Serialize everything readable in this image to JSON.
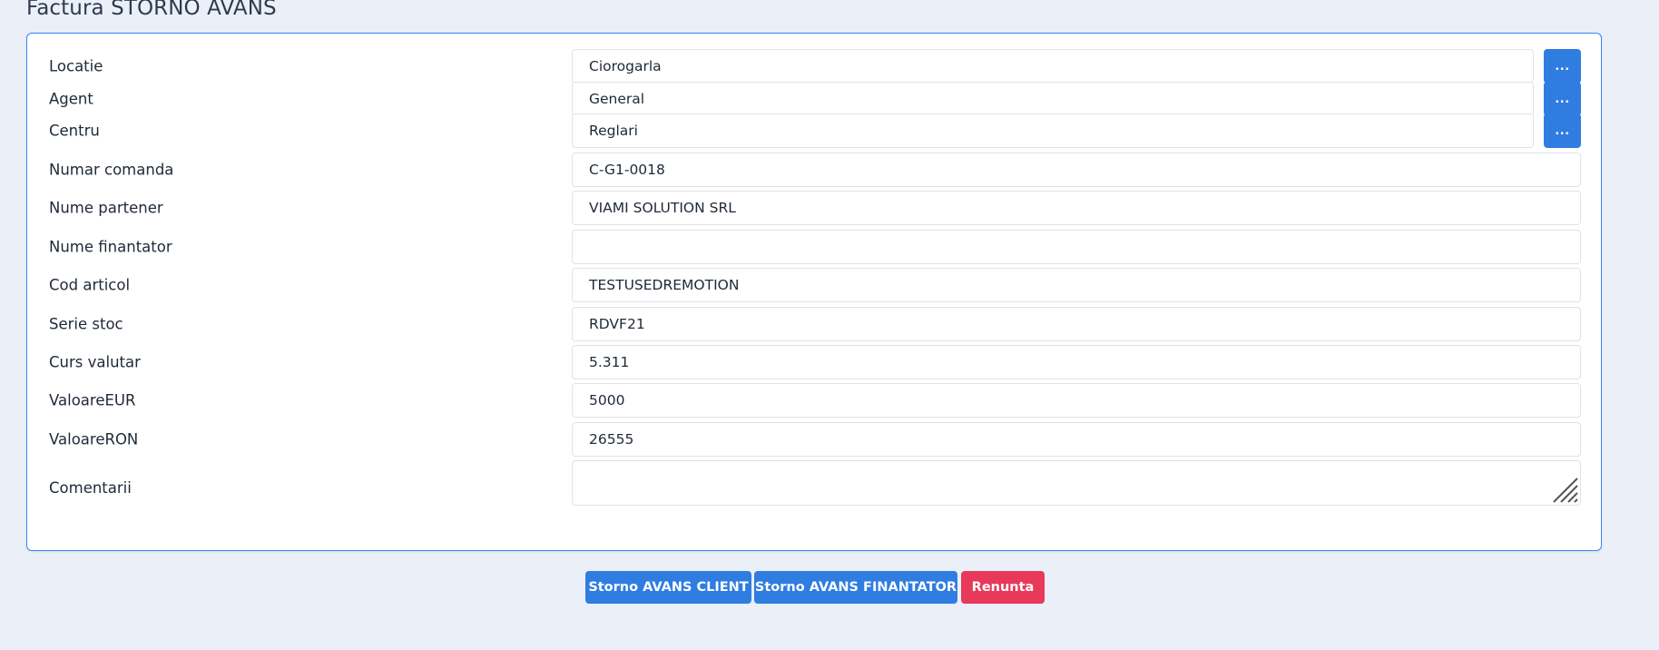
{
  "page": {
    "title": "Factura STORNO AVANS"
  },
  "form": {
    "fields": [
      {
        "label": "Locatie",
        "value": "Ciorogarla",
        "lookup_button": "..."
      },
      {
        "label": "Agent",
        "value": "General",
        "lookup_button": "..."
      },
      {
        "label": "Centru",
        "value": "Reglari",
        "lookup_button": "..."
      },
      {
        "label": "Numar comanda",
        "value": "C-G1-0018"
      },
      {
        "label": "Nume partener",
        "value": "VIAMI SOLUTION SRL"
      },
      {
        "label": "Nume finantator",
        "value": ""
      },
      {
        "label": "Cod articol",
        "value": "TESTUSEDREMOTION"
      },
      {
        "label": "Serie stoc",
        "value": "RDVF21"
      },
      {
        "label": "Curs valutar",
        "value": "5.311"
      },
      {
        "label": "ValoareEUR",
        "value": "5000"
      },
      {
        "label": "ValoareRON",
        "value": "26555"
      },
      {
        "label": "Comentarii",
        "value": ""
      }
    ]
  },
  "actions": {
    "storno_client": "Storno AVANS CLIENT",
    "storno_finantator": "Storno AVANS FINANTATOR",
    "renunta": "Renunta"
  },
  "colors": {
    "page_bg": "#ebf0f8",
    "card_border": "#3b82f6",
    "primary_button": "#2f7de1",
    "danger_button": "#e8395a"
  },
  "icons": {
    "resize_grip": "textarea-resize-grip-icon"
  }
}
